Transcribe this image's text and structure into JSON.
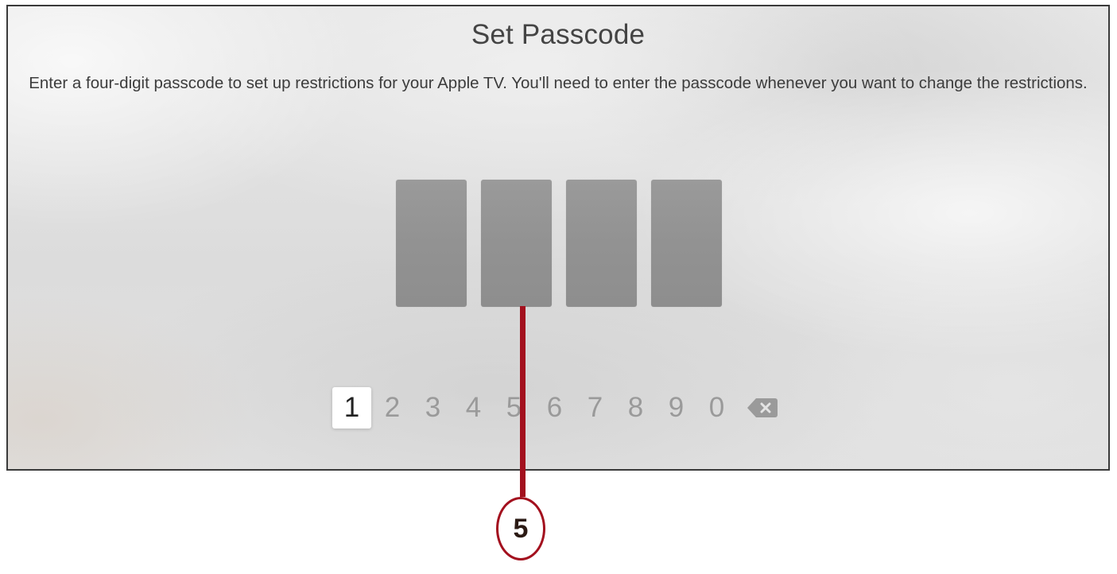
{
  "screen": {
    "title": "Set Passcode",
    "subtitle": "Enter a four-digit passcode to set up restrictions for your Apple TV. You'll need to enter the passcode whenever you want to change the restrictions."
  },
  "passcode": {
    "slot_count": 4,
    "filled_count": 0
  },
  "keypad": {
    "keys": [
      "1",
      "2",
      "3",
      "4",
      "5",
      "6",
      "7",
      "8",
      "9",
      "0"
    ],
    "focused_key": "1",
    "delete_icon": "delete-backspace-icon"
  },
  "callout": {
    "number": "5",
    "color": "#a3101e"
  },
  "colors": {
    "slot": "#959595",
    "key_inactive": "#9a9a9a",
    "key_focused_bg": "#ffffff",
    "text": "#444444"
  }
}
